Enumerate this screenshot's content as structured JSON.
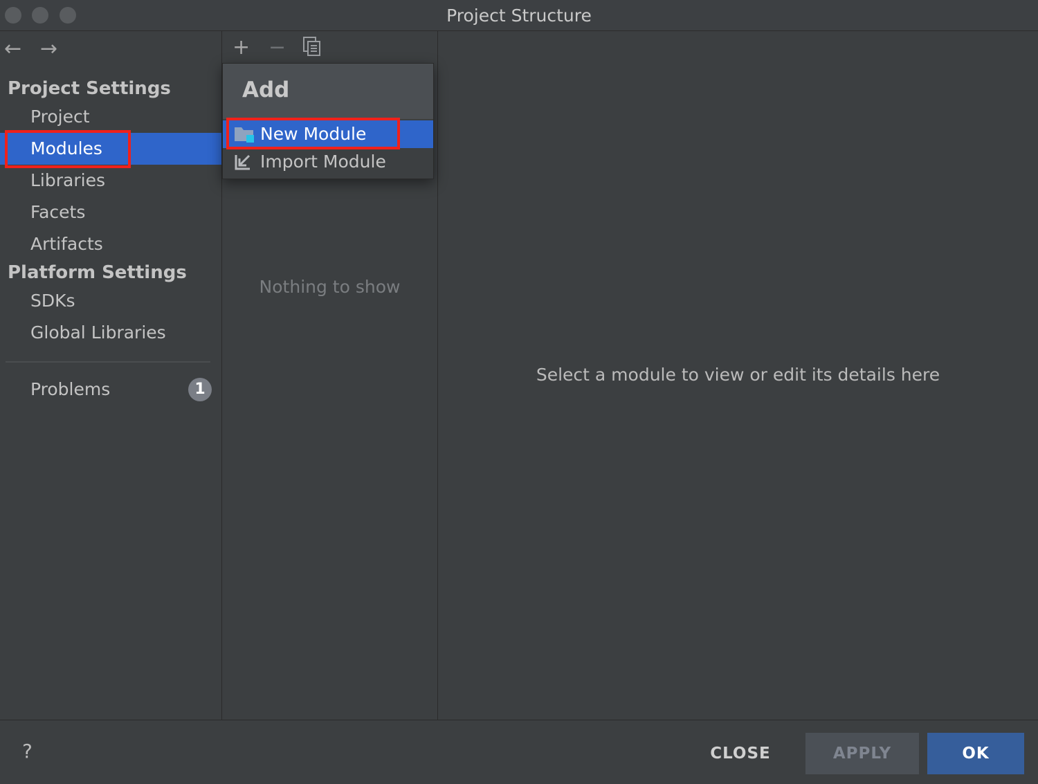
{
  "window": {
    "title": "Project Structure"
  },
  "nav": {
    "back_icon": "←",
    "forward_icon": "→"
  },
  "sidebar": {
    "project_settings_title": "Project Settings",
    "project_items": [
      {
        "label": "Project"
      },
      {
        "label": "Modules",
        "selected": true
      },
      {
        "label": "Libraries"
      },
      {
        "label": "Facets"
      },
      {
        "label": "Artifacts"
      }
    ],
    "platform_settings_title": "Platform Settings",
    "platform_items": [
      {
        "label": "SDKs"
      },
      {
        "label": "Global Libraries"
      }
    ],
    "problems": {
      "label": "Problems",
      "count": "1"
    }
  },
  "toolbar": {
    "add_icon": "+",
    "remove_icon": "−"
  },
  "add_popup": {
    "title": "Add",
    "items": [
      {
        "label": "New Module",
        "selected": true
      },
      {
        "label": "Import Module"
      }
    ]
  },
  "middle": {
    "empty_text": "Nothing to show"
  },
  "details": {
    "placeholder": "Select a module to view or edit its details here"
  },
  "footer": {
    "help_label": "?",
    "close_label": "CLOSE",
    "apply_label": "APPLY",
    "ok_label": "OK"
  },
  "colors": {
    "selection": "#2f65ca",
    "highlight_box": "#f0211b",
    "ok_button": "#365e9b"
  }
}
